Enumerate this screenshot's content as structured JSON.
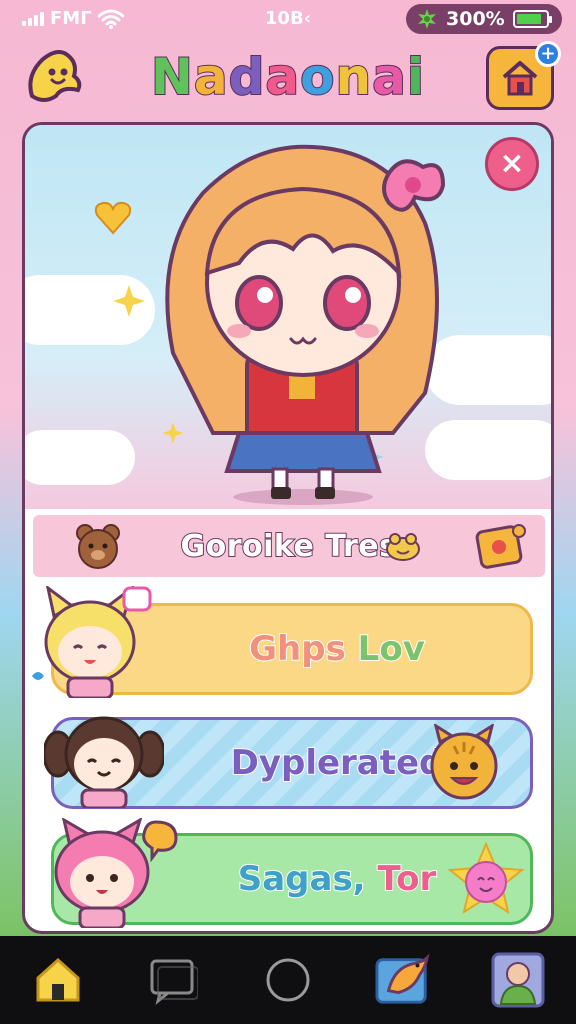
{
  "status_bar": {
    "carrier": "FMΓ",
    "time": "10Β‹",
    "battery_text": "300%",
    "battery_level": 0.85
  },
  "header": {
    "title": "Nadaonai",
    "title_letters": [
      "N",
      "a",
      "d",
      "a",
      "o",
      "n",
      "a",
      "i"
    ],
    "title_colors": [
      "#5fc25a",
      "#f2b33a",
      "#7a5fbf",
      "#f05a8c",
      "#3fa0e0",
      "#f0c43a",
      "#e85aa5",
      "#4fb75a"
    ],
    "home_plus": "+"
  },
  "card": {
    "close_label": "×",
    "profile_name": "Goroike Tres",
    "options": [
      {
        "label_parts": [
          "Ghps",
          " Lov"
        ],
        "colors": [
          "#f1907c",
          "#7bc36c"
        ]
      },
      {
        "label_parts": [
          "Dyplerated"
        ],
        "colors": [
          "#7a5fbf"
        ]
      },
      {
        "label_parts": [
          "Sagas,",
          " Tor"
        ],
        "colors": [
          "#3fa0c8",
          "#ef5f8c"
        ]
      }
    ]
  },
  "colors": {
    "accent_pink": "#ef5f8c",
    "outline": "#6a3a62",
    "home_button": "#f6b63c"
  },
  "icons": {
    "logo": "ghost-logo-icon",
    "home": "house-icon",
    "close": "close-icon",
    "nav": [
      "home-icon",
      "chat-icon",
      "circle-icon",
      "fish-icon",
      "profile-icon"
    ]
  }
}
